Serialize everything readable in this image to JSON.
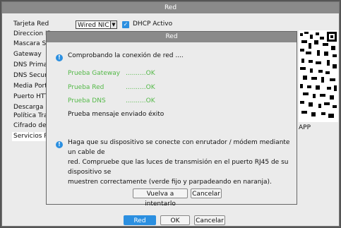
{
  "window": {
    "title": "Red"
  },
  "form": {
    "labels": [
      "Tarjeta Red",
      "Direccion IP",
      "Mascara Sub",
      "Gateway",
      "DNS Primari",
      "DNS Secund",
      "Media Port",
      "Puerto HTTF",
      "Descarga HS",
      "Política Trar",
      "Cifrado de re",
      "Servicios RE"
    ],
    "nic_value": "Wired NIC",
    "dhcp_label": "DHCP Activo",
    "app_label": "APP"
  },
  "bottom_buttons": {
    "red": "Red",
    "ok": "OK",
    "cancel": "Cancelar"
  },
  "dialog": {
    "title": "Red",
    "checking": "Comprobando la conexión de red ....",
    "tests": [
      {
        "name": "Prueba Gateway",
        "result": "..........OK"
      },
      {
        "name": "Prueba Red",
        "result": "..........OK"
      },
      {
        "name": "Prueba DNS",
        "result": "..........OK"
      }
    ],
    "sent": "Prueba mensaje enviado éxito",
    "advice_lines": [
      "Haga que su dispositivo se conecte con enrutador / módem mediante un cable de",
      "red. Compruebe que las luces de transmisión en el puerto RJ45 de su dispositivo se",
      "muestren correctamente (verde fijo y parpadeando en naranja)."
    ],
    "retry_label": "Vuelva a intentarlo",
    "cancel_label": "Cancelar"
  }
}
